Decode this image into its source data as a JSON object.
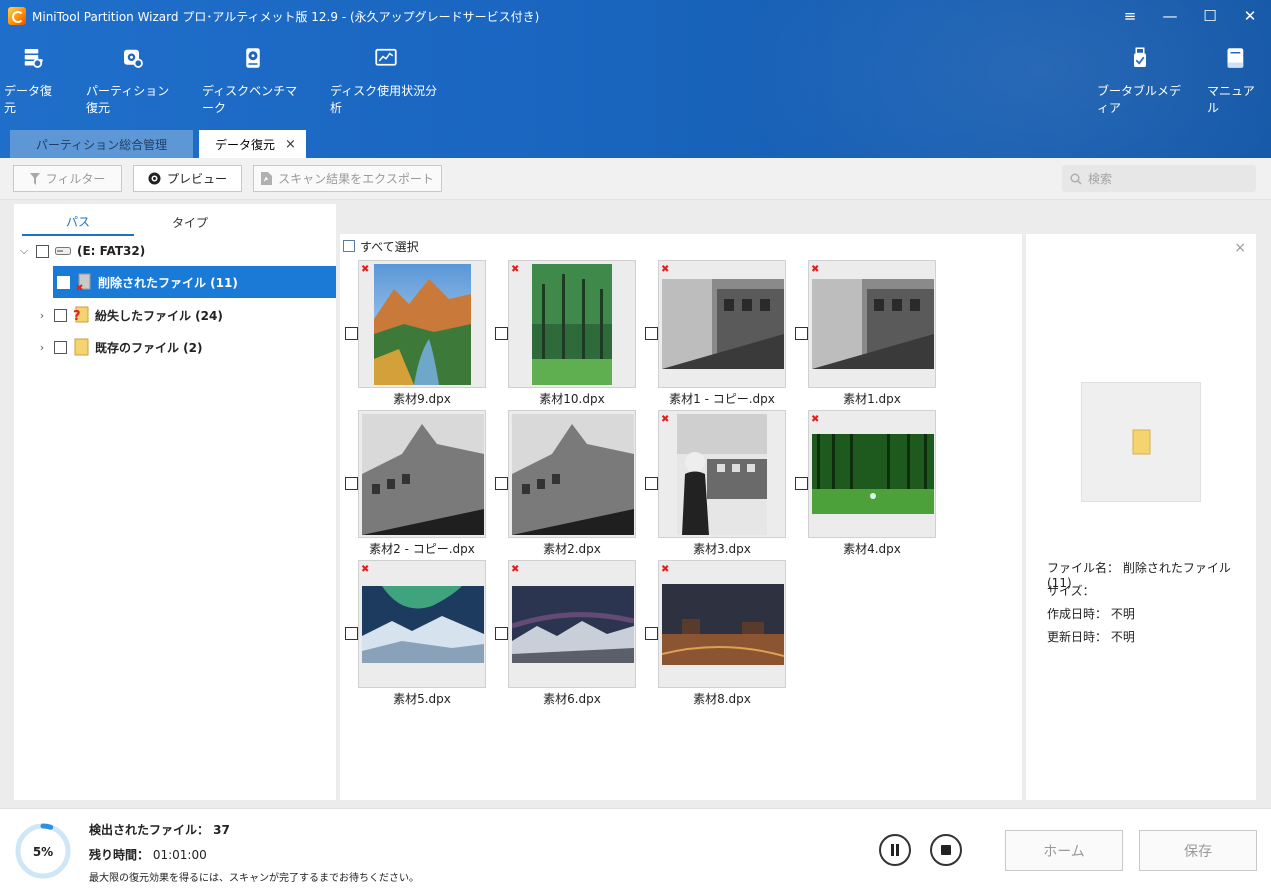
{
  "window": {
    "title": "MiniTool Partition Wizard プロ･アルティメット版 12.9 - (永久アップグレードサービス付き)",
    "controls": [
      "≡",
      "—",
      "☐",
      "✕"
    ]
  },
  "ribbon": {
    "tools": [
      {
        "label": "データ復元",
        "icon": "data-recovery-icon"
      },
      {
        "label": "パーティション復元",
        "icon": "partition-recovery-icon"
      },
      {
        "label": "ディスクベンチマーク",
        "icon": "disk-benchmark-icon"
      },
      {
        "label": "ディスク使用状況分析",
        "icon": "space-analyzer-icon"
      }
    ],
    "right_tools": [
      {
        "label": "ブータブルメディア",
        "icon": "bootable-media-icon"
      },
      {
        "label": "マニュアル",
        "icon": "manual-icon"
      }
    ]
  },
  "tabs": {
    "partition": "パーティション総合管理",
    "recovery": "データ復元",
    "close": "×"
  },
  "actionbar": {
    "filter": "フィルター",
    "preview": "プレビュー",
    "export": "スキャン結果をエクスポート",
    "search_placeholder": "検索"
  },
  "left": {
    "tab_path": "パス",
    "tab_type": "タイプ",
    "drive": "(E: FAT32)",
    "deleted": "削除されたファイル (11)",
    "lost": "紛失したファイル (24)",
    "existing": "既存のファイル (2)"
  },
  "grid": {
    "select_all": "すべて選択",
    "files": [
      {
        "name": "素材9.dpx",
        "thumb": "canyon-river"
      },
      {
        "name": "素材10.dpx",
        "thumb": "green-trees"
      },
      {
        "name": "素材1 - コピー.dpx",
        "thumb": "bw-building-1"
      },
      {
        "name": "素材1.dpx",
        "thumb": "bw-building-1"
      },
      {
        "name": "素材2 - コピー.dpx",
        "thumb": "bw-building-2"
      },
      {
        "name": "素材2.dpx",
        "thumb": "bw-building-2"
      },
      {
        "name": "素材3.dpx",
        "thumb": "bw-woman-street"
      },
      {
        "name": "素材4.dpx",
        "thumb": "green-forest"
      },
      {
        "name": "素材5.dpx",
        "thumb": "aurora-snow"
      },
      {
        "name": "素材6.dpx",
        "thumb": "night-mountains"
      },
      {
        "name": "素材8.dpx",
        "thumb": "desert-night"
      }
    ]
  },
  "details": {
    "close": "×",
    "file_name": "ファイル名：  削除されたファイル (11)",
    "size": "サイズ：",
    "created": "作成日時：  不明",
    "modified": "更新日時：  不明"
  },
  "status": {
    "progress": "5%",
    "progress_value": 0.05,
    "found_label": "検出されたファイル： 37",
    "remaining_label": "残り時間：",
    "remaining_value": "01:01:00",
    "hint": "最大限の復元効果を得るには、スキャンが完了するまでお待ちください。",
    "home": "ホーム",
    "save": "保存"
  },
  "colors": {
    "ribbon": "#1a66c0",
    "accent": "#1a7ad6",
    "deleted_mark": "#e02020"
  }
}
